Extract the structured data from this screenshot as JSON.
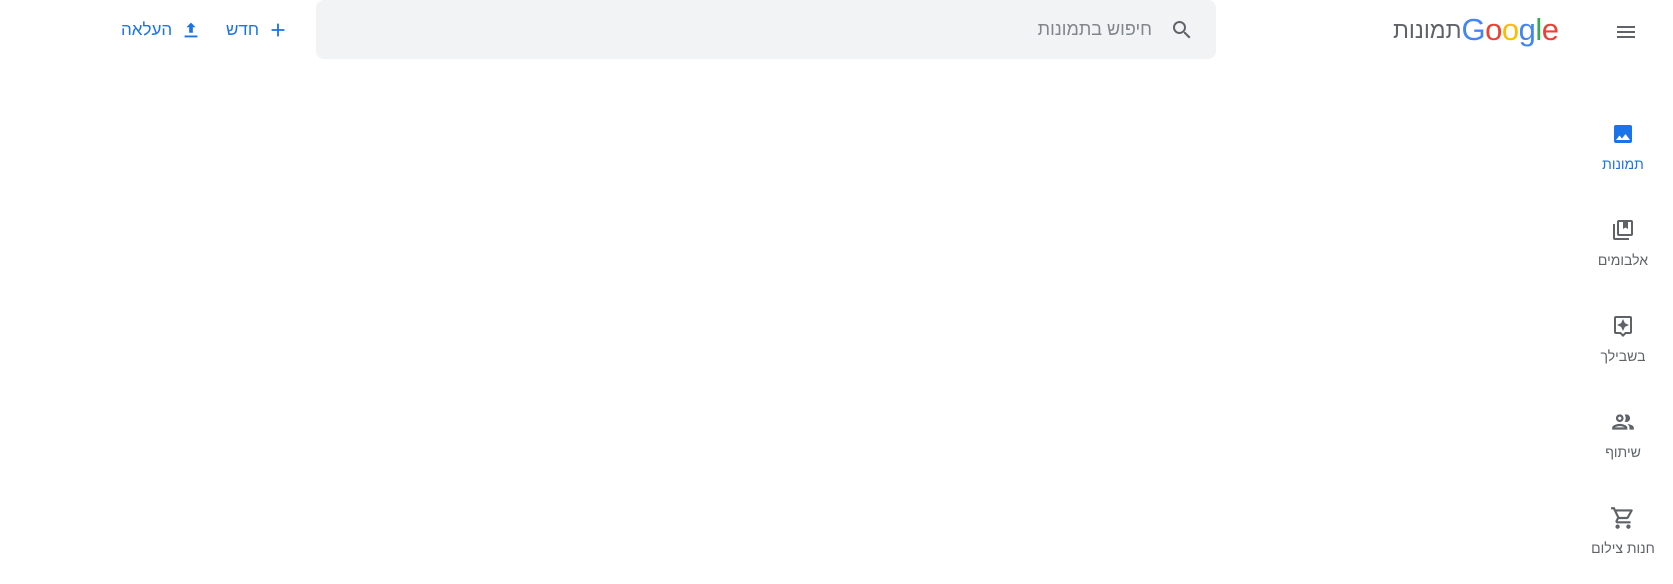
{
  "header": {
    "menu_icon": "hamburger-menu-icon",
    "logo_letters": [
      "G",
      "o",
      "o",
      "g",
      "l",
      "e"
    ],
    "logo_colors": [
      "#4285F4",
      "#EA4335",
      "#FBBC05",
      "#4285F4",
      "#34A853",
      "#EA4335"
    ],
    "product_name": "תמונות",
    "search": {
      "placeholder": "חיפוש בתמונות",
      "value": ""
    },
    "new_label": "חדש",
    "upload_label": "העלאה"
  },
  "sidenav": {
    "items": [
      {
        "label": "תמונות",
        "icon": "photo-icon",
        "active": true
      },
      {
        "label": "אלבומים",
        "icon": "album-icon",
        "active": false
      },
      {
        "label": "בשבילך",
        "icon": "for-you-icon",
        "active": false
      },
      {
        "label": "שיתוף",
        "icon": "sharing-icon",
        "active": false
      },
      {
        "label": "חנות צילום",
        "icon": "cart-icon",
        "active": false
      }
    ]
  },
  "colors": {
    "accent": "#1a73e8",
    "text": "#5f6368",
    "search_bg": "#f1f3f4"
  }
}
